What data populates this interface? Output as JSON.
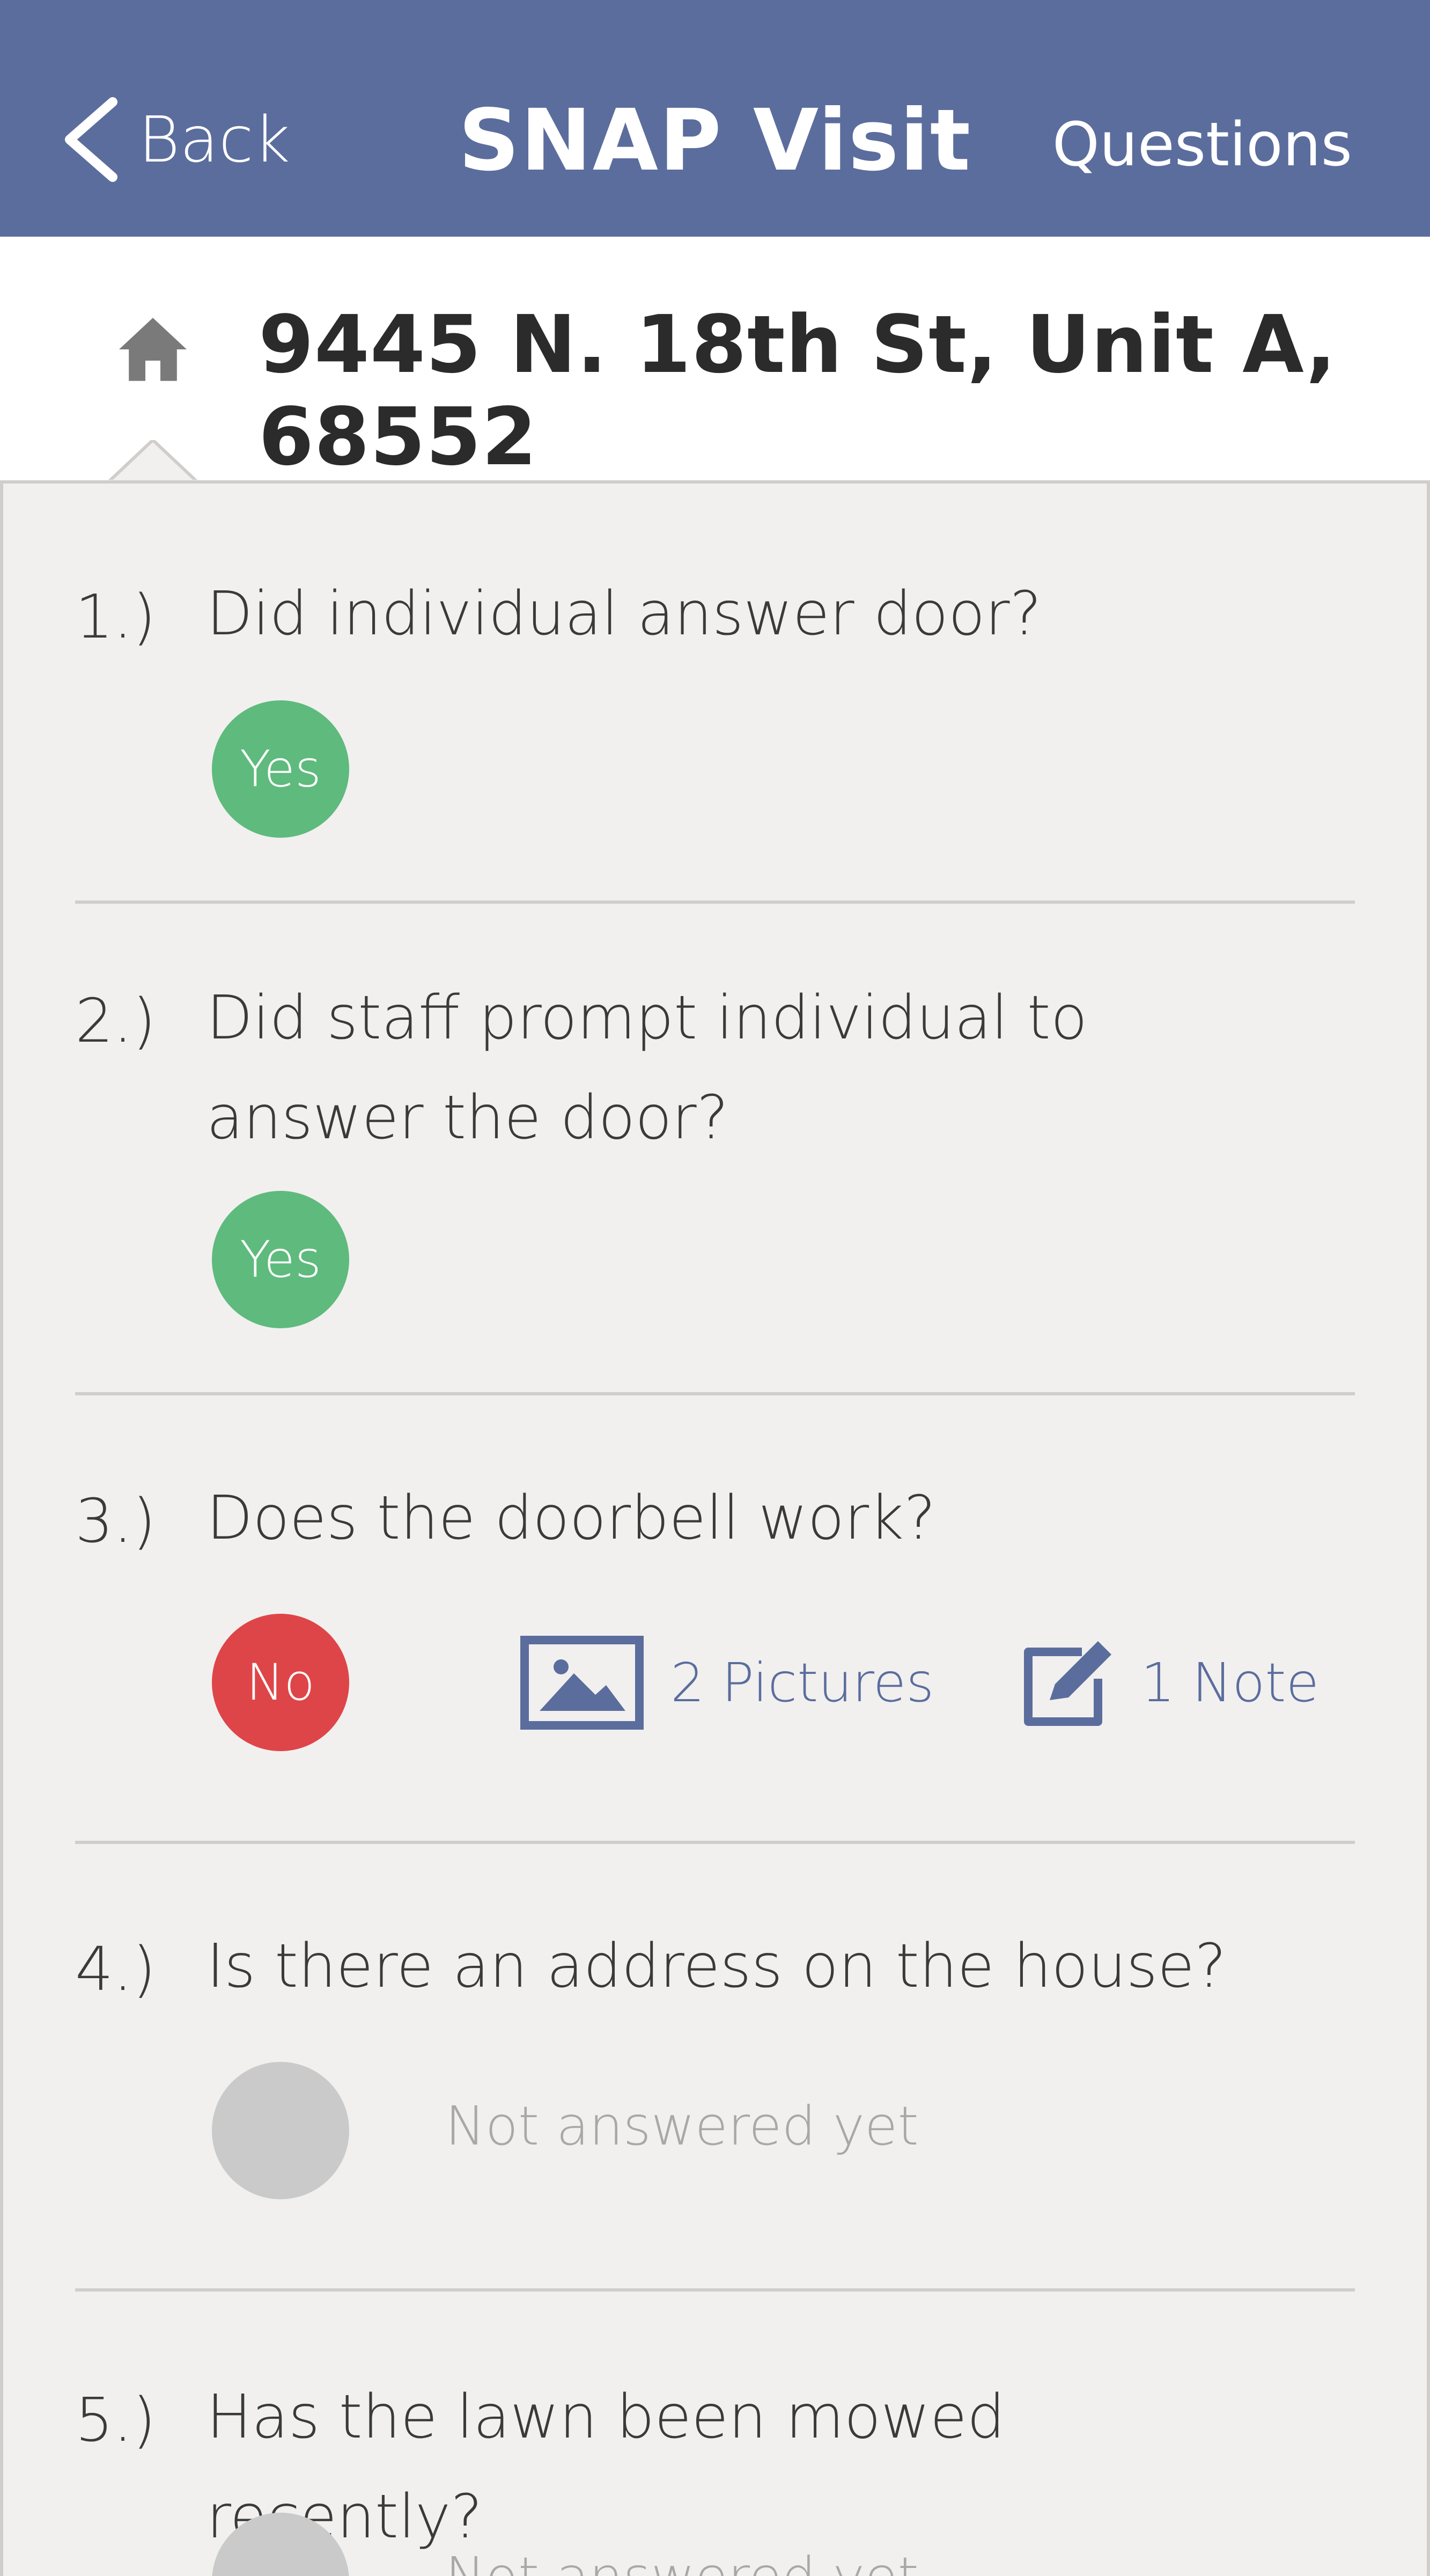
{
  "header": {
    "back_label": "Back",
    "title": "SNAP Visit",
    "questions_label": "Questions"
  },
  "address": {
    "text": "9445 N. 18th St, Unit A, 68552"
  },
  "questions": [
    {
      "number": "1.)",
      "text": "Did individual answer door?",
      "answer": "Yes"
    },
    {
      "number": "2.)",
      "text": "Did staff prompt individual to answer the door?",
      "answer": "Yes"
    },
    {
      "number": "3.)",
      "text": "Does the doorbell work?",
      "answer": "No",
      "pictures": "2 Pictures",
      "notes": "1 Note"
    },
    {
      "number": "4.)",
      "text": "Is there an address on the house?",
      "status": "Not answered yet"
    },
    {
      "number": "5.)",
      "text": "Has the lawn been mowed recently?",
      "status": "Not answered yet"
    }
  ],
  "colors": {
    "header_bg": "#5b6d9d",
    "yes": "#5fba7d",
    "no": "#de4548",
    "pending": "#cacaca",
    "link": "#5b6d9d"
  }
}
